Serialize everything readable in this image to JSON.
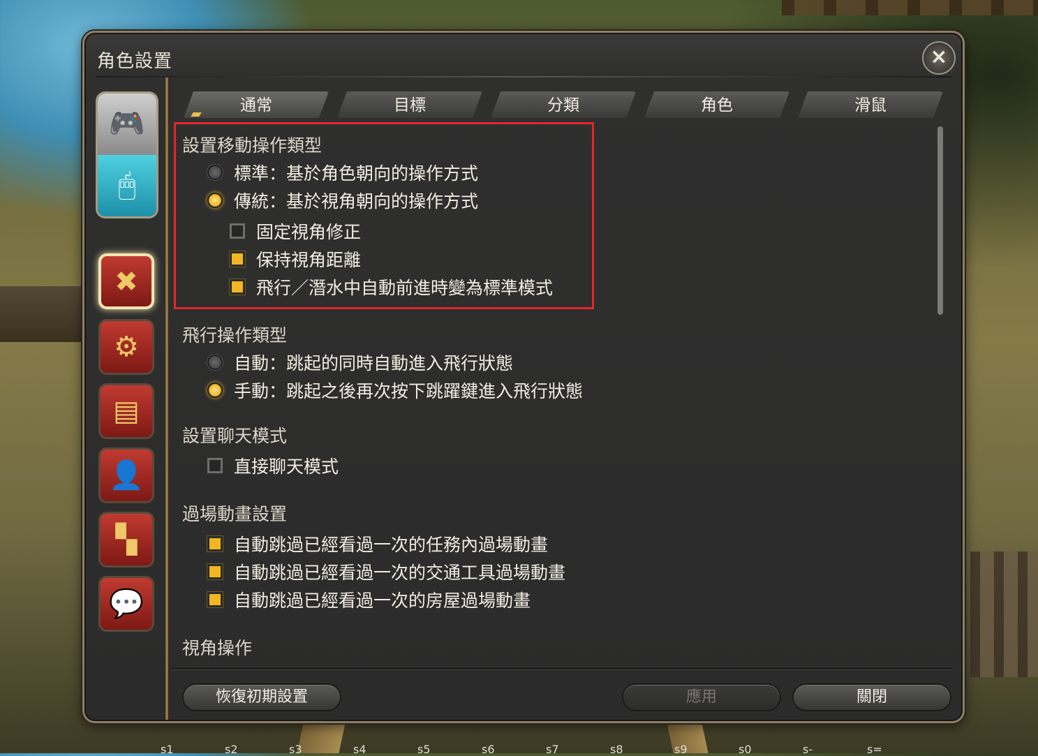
{
  "window": {
    "title": "角色設置",
    "close_icon": "×"
  },
  "left_rail": {
    "mode_switch": {
      "gamepad_icon": "🎮",
      "mouse_icon": "🖱"
    },
    "categories": [
      {
        "name": "movement",
        "icon": "✖",
        "active": true
      },
      {
        "name": "items-gear",
        "icon": "⚙",
        "active": false
      },
      {
        "name": "card",
        "icon": "▤",
        "active": false
      },
      {
        "name": "character",
        "icon": "👤",
        "active": false
      },
      {
        "name": "tracks",
        "icon": "▚",
        "active": false
      },
      {
        "name": "chat",
        "icon": "💬",
        "active": false
      }
    ]
  },
  "tabs": [
    "通常",
    "目標",
    "分類",
    "角色",
    "滑鼠"
  ],
  "sections": {
    "movement_type": {
      "title": "設置移動操作類型",
      "options": [
        {
          "label": "標準：基於角色朝向的操作方式",
          "selected": false
        },
        {
          "label": "傳統：基於視角朝向的操作方式",
          "selected": true
        }
      ],
      "checks": [
        {
          "label": "固定視角修正",
          "checked": false
        },
        {
          "label": "保持視角距離",
          "checked": true
        },
        {
          "label": "飛行／潛水中自動前進時變為標準模式",
          "checked": true
        }
      ]
    },
    "flight_type": {
      "title": "飛行操作類型",
      "options": [
        {
          "label": "自動：跳起的同時自動進入飛行狀態",
          "selected": false
        },
        {
          "label": "手動：跳起之後再次按下跳躍鍵進入飛行狀態",
          "selected": true
        }
      ]
    },
    "chat_mode": {
      "title": "設置聊天模式",
      "checks": [
        {
          "label": "直接聊天模式",
          "checked": false
        }
      ]
    },
    "cutscene": {
      "title": "過場動畫設置",
      "checks": [
        {
          "label": "自動跳過已經看過一次的任務內過場動畫",
          "checked": true
        },
        {
          "label": "自動跳過已經看過一次的交通工具過場動畫",
          "checked": true
        },
        {
          "label": "自動跳過已經看過一次的房屋過場動畫",
          "checked": true
        }
      ]
    },
    "camera": {
      "title": "視角操作"
    }
  },
  "footer": {
    "reset_label": "恢復初期設置",
    "apply_label": "應用",
    "close_label": "關閉"
  },
  "hotbar": [
    "s1",
    "s2",
    "s3",
    "s4",
    "s5",
    "s6",
    "s7",
    "s8",
    "s9",
    "s0",
    "s-",
    "s="
  ],
  "colors": {
    "highlight_border": "#e3262a",
    "active_option": "#f2b624",
    "accent_gold": "#b38a48"
  }
}
